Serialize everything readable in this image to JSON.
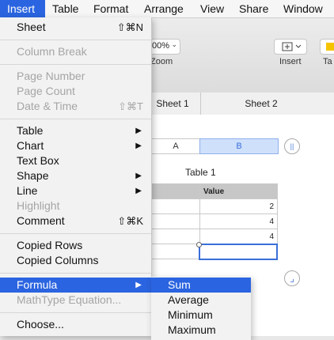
{
  "menubar": {
    "items": [
      "Insert",
      "Table",
      "Format",
      "Arrange",
      "View",
      "Share",
      "Window"
    ]
  },
  "toolbar": {
    "zoom_value": "00%",
    "zoom_label": "Zoom",
    "insert_label": "Insert",
    "table_label": "Ta"
  },
  "sheets": [
    "Sheet 1",
    "Sheet 2"
  ],
  "canvas": {
    "col_headers": [
      "A",
      "B"
    ],
    "table_title": "Table 1",
    "value_header": "Value",
    "values": [
      "2",
      "4",
      "4"
    ]
  },
  "insert_menu": {
    "sheet": "Sheet",
    "sheet_sc": "⇧⌘N",
    "column_break": "Column Break",
    "page_number": "Page Number",
    "page_count": "Page Count",
    "date_time": "Date & Time",
    "date_time_sc": "⇧⌘T",
    "table": "Table",
    "chart": "Chart",
    "text_box": "Text Box",
    "shape": "Shape",
    "line": "Line",
    "highlight": "Highlight",
    "comment": "Comment",
    "comment_sc": "⇧⌘K",
    "copied_rows": "Copied Rows",
    "copied_columns": "Copied Columns",
    "formula": "Formula",
    "mathtype": "MathType Equation...",
    "choose": "Choose..."
  },
  "formula_submenu": [
    "Sum",
    "Average",
    "Minimum",
    "Maximum"
  ],
  "colors": {
    "highlight": "#2b64e0",
    "menu_bg": "#f2f2f2"
  }
}
